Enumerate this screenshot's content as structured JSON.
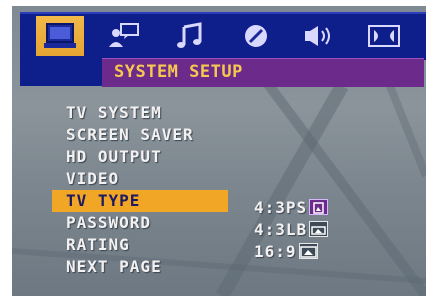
{
  "tabs": [
    {
      "name": "monitor-icon",
      "active": true
    },
    {
      "name": "user-speech-icon",
      "active": false
    },
    {
      "name": "music-note-icon",
      "active": false
    },
    {
      "name": "disc-icon",
      "active": false
    },
    {
      "name": "speaker-icon",
      "active": false
    },
    {
      "name": "dolby-icon",
      "active": false
    }
  ],
  "header": {
    "title": "SYSTEM SETUP"
  },
  "menu": {
    "items": [
      {
        "label": "TV SYSTEM"
      },
      {
        "label": "SCREEN SAVER"
      },
      {
        "label": "HD OUTPUT"
      },
      {
        "label": "VIDEO"
      },
      {
        "label": "TV TYPE",
        "selected": true
      },
      {
        "label": "PASSWORD"
      },
      {
        "label": "RATING"
      },
      {
        "label": "NEXT PAGE"
      }
    ]
  },
  "tv_type_options": [
    {
      "label": "4:3PS",
      "icon": "ps-aspect-icon",
      "selected": true
    },
    {
      "label": "4:3LB",
      "icon": "lb-aspect-icon",
      "selected": false
    },
    {
      "label": "16:9",
      "icon": "wide-aspect-icon",
      "selected": false
    }
  ],
  "colors": {
    "accent": "#f1a725",
    "topbar": "#0e1e8a",
    "titlebar": "#6c2a8b",
    "title_text": "#f7c850"
  }
}
